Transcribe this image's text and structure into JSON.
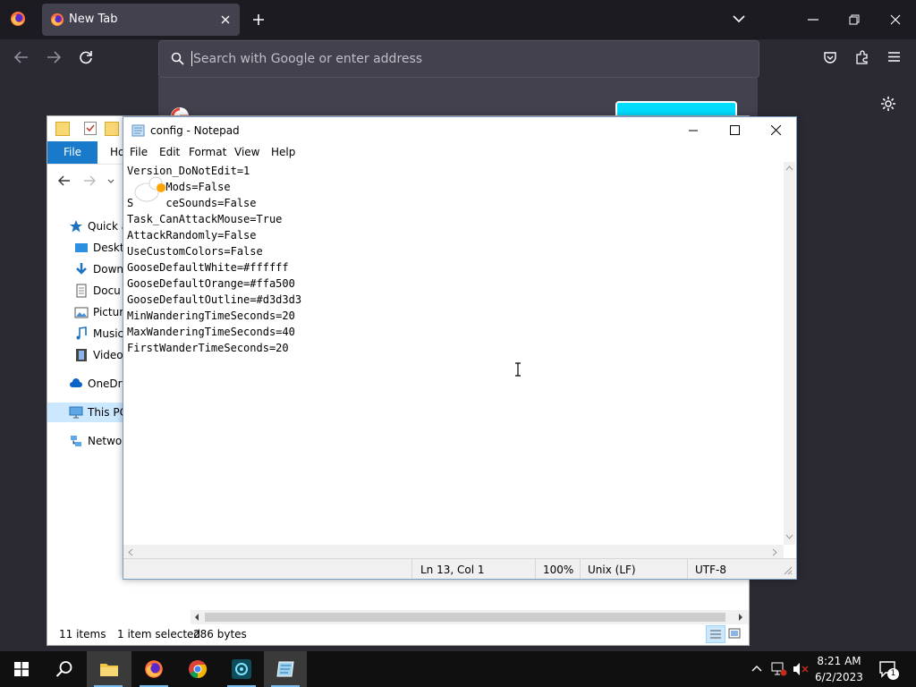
{
  "firefox": {
    "tab_title": "New Tab",
    "url_placeholder": "Search with Google or enter address"
  },
  "explorer": {
    "ribbon": {
      "file": "File",
      "home": "Ho"
    },
    "nav": {
      "quick_access": "Quick a",
      "desktop": "Deskto",
      "downloads": "Down",
      "documents": "Docu",
      "pictures": "Pictur",
      "music": "Music",
      "videos": "Videos",
      "onedrive": "OneDriv",
      "this_pc": "This PC",
      "network": "Networ"
    },
    "status": {
      "items": "11 items",
      "selected": "1 item selected",
      "size": "286 bytes"
    }
  },
  "notepad": {
    "title": "config - Notepad",
    "menu": [
      "File",
      "Edit",
      "Format",
      "View",
      "Help"
    ],
    "content": "Version_DoNotEdit=1\n     eMods=False\nS     ceSounds=False\nTask_CanAttackMouse=True\nAttackRandomly=False\nUseCustomColors=False\nGooseDefaultWhite=#ffffff\nGooseDefaultOrange=#ffa500\nGooseDefaultOutline=#d3d3d3\nMinWanderingTimeSeconds=20\nMaxWanderingTimeSeconds=40\nFirstWanderTimeSeconds=20",
    "status": {
      "position": "Ln 13, Col 1",
      "zoom": "100%",
      "line_ending": "Unix (LF)",
      "encoding": "UTF-8"
    }
  },
  "taskbar": {
    "apps": [
      "start",
      "search",
      "file-explorer",
      "firefox",
      "chrome",
      "app-teal",
      "notepad"
    ],
    "time": "8:21 AM",
    "date": "6/2/2023",
    "notification_badge": "1"
  },
  "colors": {
    "accent": "#0078d7",
    "firefox_bg": "#1c1b22",
    "explorer_file_tab": "#1979ca"
  }
}
